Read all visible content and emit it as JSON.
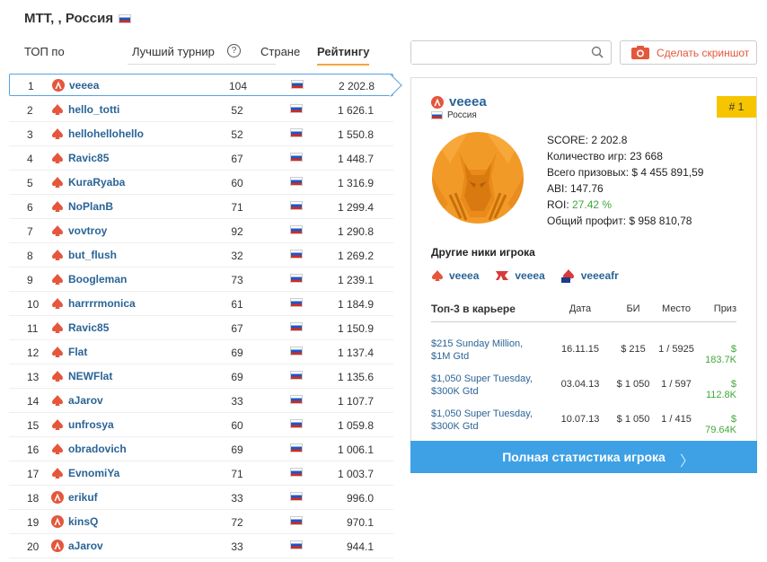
{
  "page": {
    "title": "MTT, , Россия"
  },
  "filters": {
    "top_label": "ТОП по",
    "best_tournament": "Лучший турнир",
    "help_icon": "?",
    "country": "Стране",
    "rating": "Рейтингу"
  },
  "ranking": [
    {
      "rank": "1",
      "name": "veeea",
      "room": "red",
      "games": "104",
      "score": "2 202.8"
    },
    {
      "rank": "2",
      "name": "hello_totti",
      "room": "spade",
      "games": "52",
      "score": "1 626.1"
    },
    {
      "rank": "3",
      "name": "hellohellohello",
      "room": "spade",
      "games": "52",
      "score": "1 550.8"
    },
    {
      "rank": "4",
      "name": "Ravic85",
      "room": "spade",
      "games": "67",
      "score": "1 448.7"
    },
    {
      "rank": "5",
      "name": "KuraRyaba",
      "room": "spade",
      "games": "60",
      "score": "1 316.9"
    },
    {
      "rank": "6",
      "name": "NoPlanB",
      "room": "spade",
      "games": "71",
      "score": "1 299.4"
    },
    {
      "rank": "7",
      "name": "vovtroy",
      "room": "spade",
      "games": "92",
      "score": "1 290.8"
    },
    {
      "rank": "8",
      "name": "but_flush",
      "room": "spade",
      "games": "32",
      "score": "1 269.2"
    },
    {
      "rank": "9",
      "name": "Boogleman",
      "room": "spade",
      "games": "73",
      "score": "1 239.1"
    },
    {
      "rank": "10",
      "name": "harrrrmonica",
      "room": "spade",
      "games": "61",
      "score": "1 184.9"
    },
    {
      "rank": "11",
      "name": "Ravic85",
      "room": "spade",
      "games": "67",
      "score": "1 150.9"
    },
    {
      "rank": "12",
      "name": "Flat",
      "room": "spade",
      "games": "69",
      "score": "1 137.4"
    },
    {
      "rank": "13",
      "name": "NEWFlat",
      "room": "spade",
      "games": "69",
      "score": "1 135.6"
    },
    {
      "rank": "14",
      "name": "aJarov",
      "room": "spade",
      "games": "33",
      "score": "1 107.7"
    },
    {
      "rank": "15",
      "name": "unfrosya",
      "room": "spade",
      "games": "60",
      "score": "1 059.8"
    },
    {
      "rank": "16",
      "name": "obradovich",
      "room": "spade",
      "games": "69",
      "score": "1 006.1"
    },
    {
      "rank": "17",
      "name": "EvnomiYa",
      "room": "spade",
      "games": "71",
      "score": "1 003.7"
    },
    {
      "rank": "18",
      "name": "erikuf",
      "room": "red",
      "games": "33",
      "score": "996.0"
    },
    {
      "rank": "19",
      "name": "kinsQ",
      "room": "red",
      "games": "72",
      "score": "970.1"
    },
    {
      "rank": "20",
      "name": "aJarov",
      "room": "red",
      "games": "33",
      "score": "944.1"
    }
  ],
  "search": {
    "placeholder": ""
  },
  "screenshot_button": "Сделать скриншот",
  "player": {
    "name": "veeea",
    "country": "Россия",
    "rank": "# 1",
    "stats": {
      "score": "SCORE: 2 202.8",
      "games": "Количество игр: 23 668",
      "prizes": "Всего призовых: $ 4 455 891,59",
      "abi": "ABI: 147.76",
      "roi_label": "ROI: ",
      "roi_value": "27.42 %",
      "profit": "Общий профит: $ 958 810,78"
    },
    "other_nicks_title": "Другие ники игрока",
    "other_nicks": [
      {
        "name": "veeea",
        "icon": "spade-icon"
      },
      {
        "name": "veeea",
        "icon": "party-icon"
      },
      {
        "name": "veeeafr",
        "icon": "fr-icon"
      }
    ],
    "top3": {
      "title": "Топ-3 в карьере",
      "headers": {
        "date": "Дата",
        "buyin": "БИ",
        "place": "Место",
        "prize": "Приз"
      },
      "rows": [
        {
          "name": "$215 Sunday Million, $1M Gtd",
          "date": "16.11.15",
          "buyin": "$ 215",
          "place": "1 / 5925",
          "prize": "$ 183.7K"
        },
        {
          "name": "$1,050 Super Tuesday, $300K Gtd",
          "date": "03.04.13",
          "buyin": "$ 1 050",
          "place": "1 / 597",
          "prize": "$ 112.8K"
        },
        {
          "name": "$1,050 Super Tuesday, $300K Gtd",
          "date": "10.07.13",
          "buyin": "$ 1 050",
          "place": "1 / 415",
          "prize": "$ 79.64K"
        }
      ]
    },
    "full_stats_button": "Полная статистика игрока",
    "chevron": "〉"
  }
}
